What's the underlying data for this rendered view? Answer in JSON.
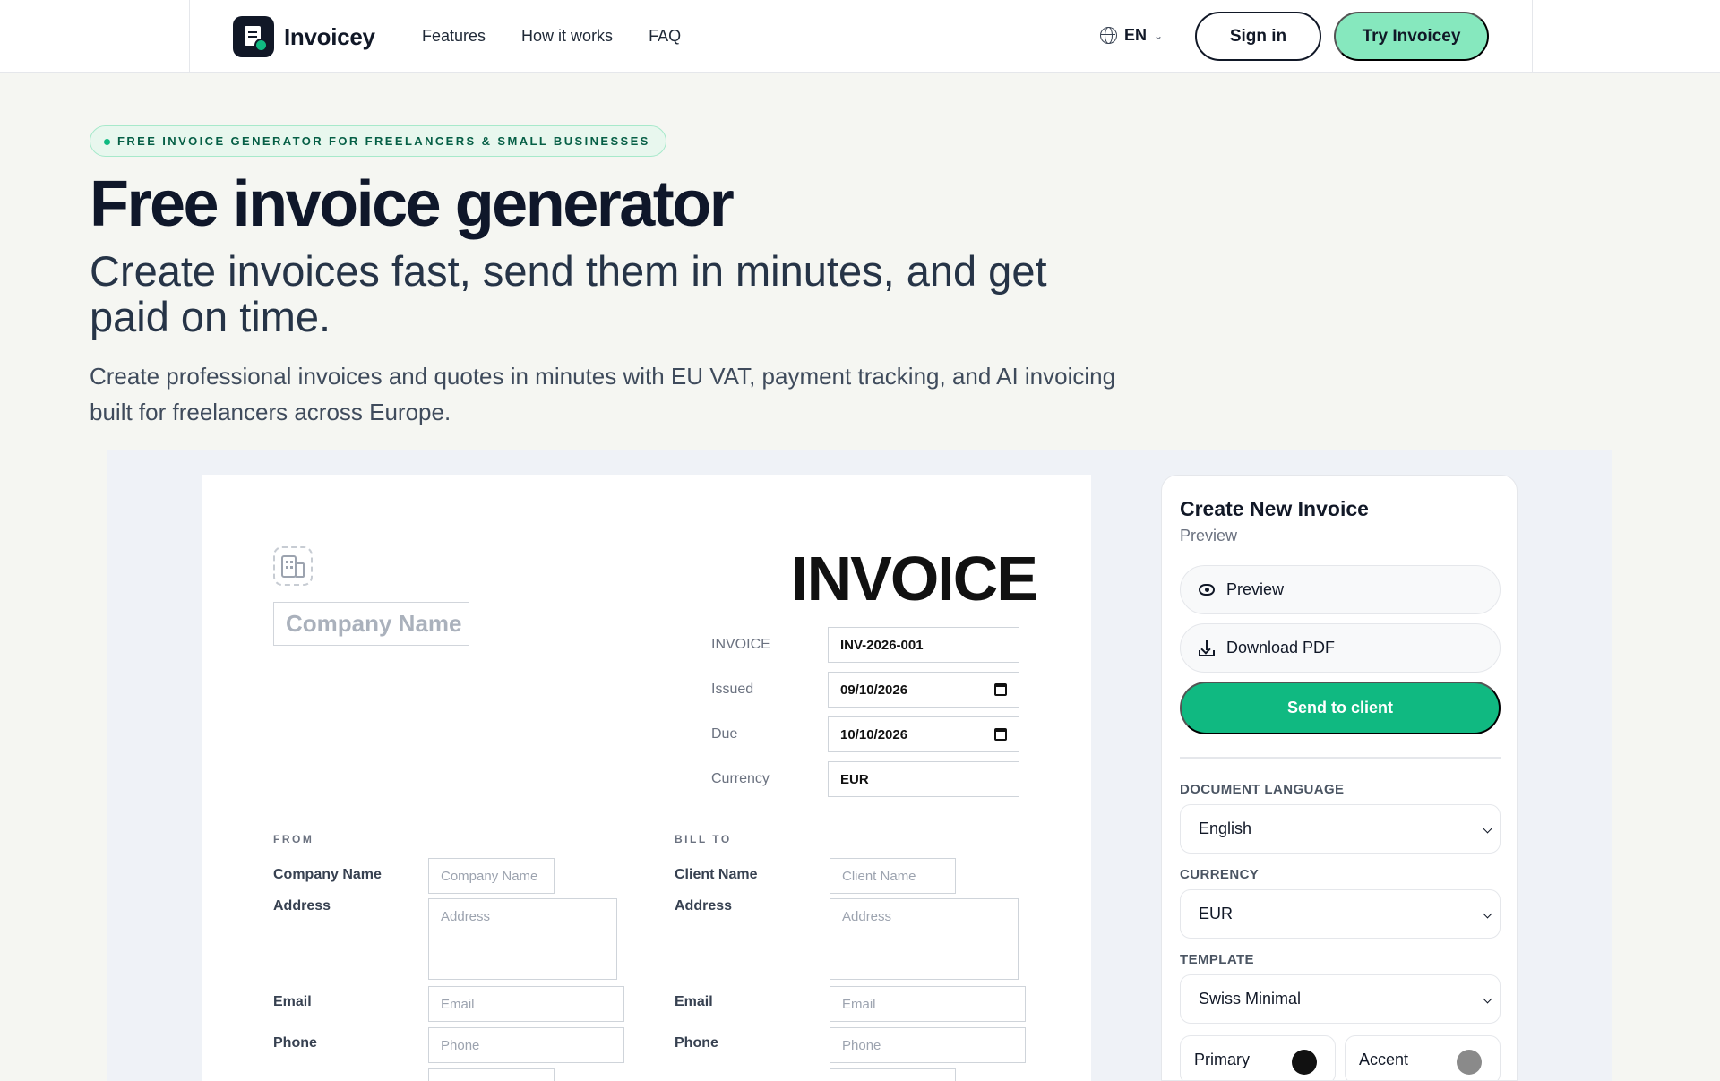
{
  "nav": {
    "brand": "Invoicey",
    "links": [
      "Features",
      "How it works",
      "FAQ"
    ],
    "language": "EN",
    "sign_in": "Sign in",
    "try": "Try Invoicey"
  },
  "hero": {
    "badge": "FREE INVOICE GENERATOR FOR FREELANCERS & SMALL BUSINESSES",
    "title": "Free invoice generator",
    "subtitle": "Create invoices fast, send them in minutes, and get paid on time.",
    "description": "Create professional invoices and quotes in minutes with EU VAT, payment tracking, and AI invoicing built for freelancers across Europe."
  },
  "invoice": {
    "company_name_placeholder": "Company Name",
    "title": "INVOICE",
    "meta": [
      {
        "label": "INVOICE",
        "value": "INV-2026-001"
      },
      {
        "label": "Issued",
        "value": "09/10/2026"
      },
      {
        "label": "Due",
        "value": "10/10/2026"
      },
      {
        "label": "Currency",
        "value": "EUR"
      }
    ],
    "from": {
      "heading": "FROM",
      "company_label": "Company Name",
      "company_placeholder": "Company Name",
      "address_label": "Address",
      "address_placeholder": "Address",
      "email_label": "Email",
      "email_placeholder": "Email",
      "phone_label": "Phone",
      "phone_placeholder": "Phone"
    },
    "bill_to": {
      "heading": "BILL TO",
      "client_label": "Client Name",
      "client_placeholder": "Client Name",
      "address_label": "Address",
      "address_placeholder": "Address",
      "email_label": "Email",
      "email_placeholder": "Email",
      "phone_label": "Phone",
      "phone_placeholder": "Phone"
    }
  },
  "panel": {
    "title": "Create New Invoice",
    "subtitle": "Preview",
    "preview": "Preview",
    "download": "Download PDF",
    "send": "Send to client",
    "doc_lang_label": "DOCUMENT LANGUAGE",
    "doc_lang_value": "English",
    "currency_label": "CURRENCY",
    "currency_value": "EUR",
    "template_label": "TEMPLATE",
    "template_value": "Swiss Minimal",
    "primary_label": "Primary",
    "primary_color": "#111111",
    "accent_label": "Accent",
    "accent_color": "#8a8a8a"
  }
}
